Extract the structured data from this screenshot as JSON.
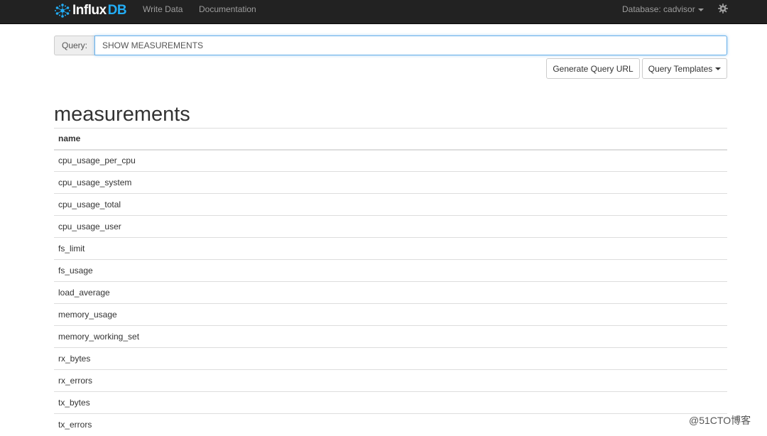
{
  "navbar": {
    "brand_influx": "Influx",
    "brand_db": "DB",
    "links": [
      {
        "label": "Write Data"
      },
      {
        "label": "Documentation"
      }
    ],
    "database_label": "Database: cadvisor",
    "colors": {
      "background": "#222222",
      "link": "#9d9d9d",
      "brand_accent": "#22adf6"
    }
  },
  "query": {
    "label": "Query:",
    "value": "SHOW MEASUREMENTS"
  },
  "buttons": {
    "generate_url": "Generate Query URL",
    "templates": "Query Templates"
  },
  "series": {
    "title": "measurements",
    "columns": [
      "name"
    ],
    "rows": [
      "cpu_usage_per_cpu",
      "cpu_usage_system",
      "cpu_usage_total",
      "cpu_usage_user",
      "fs_limit",
      "fs_usage",
      "load_average",
      "memory_usage",
      "memory_working_set",
      "rx_bytes",
      "rx_errors",
      "tx_bytes",
      "tx_errors"
    ]
  },
  "watermark": "@51CTO博客"
}
